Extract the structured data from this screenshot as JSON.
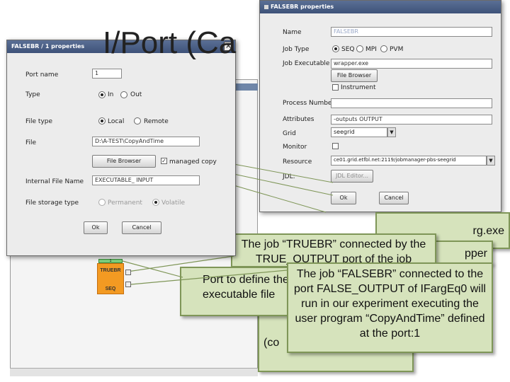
{
  "slide": {
    "title": "I/Port (Ca"
  },
  "workflow": {
    "job_node": {
      "top_label": "TRUEBR",
      "bottom_label": "SEQ",
      "input_port": "1"
    }
  },
  "callouts": {
    "back_right_tail": "rg.exe",
    "back_right_tail2": "pper",
    "truebr": "The job “TRUEBR” connected by the TRUE_OUTPUT port of the job",
    "port_to": "Port to define the executable file",
    "falsebr": "The job “FALSEBR” connected to the port FALSE_OUTPUT of IFargEq0 will run in our experiment executing the user program “CopyAndTime” defined at the port:1",
    "back_bottom": "(co"
  },
  "port_dialog": {
    "title": "FALSEBR / 1 properties",
    "port_name_label": "Port name",
    "port_name_value": "1",
    "type_label": "Type",
    "type_in": "In",
    "type_out": "Out",
    "file_type_label": "File type",
    "file_type_local": "Local",
    "file_type_remote": "Remote",
    "file_label": "File",
    "file_value": "D:\\A-TEST\\CopyAndTime",
    "file_browser_button": "File Browser",
    "managed_copy_label": "managed copy",
    "internal_name_label": "Internal File Name",
    "internal_name_value": "EXECUTABLE_ INPUT",
    "storage_label": "File storage type",
    "storage_permanent": "Permanent",
    "storage_volatile": "Volatile",
    "ok_button": "Ok",
    "cancel_button": "Cancel"
  },
  "job_dialog": {
    "title": "FALSEBR properties",
    "name_label": "Name",
    "name_value": "FALSEBR",
    "job_type_label": "Job Type",
    "job_type_seq": "SEQ",
    "job_type_mpi": "MPI",
    "job_type_pvm": "PVM",
    "job_exec_label": "Job Executable",
    "job_exec_value": "wrapper.exe",
    "file_browser_button": "File Browser",
    "instrument_label": "Instrument",
    "process_number_label": "Process Number",
    "attributes_label": "Attributes",
    "attributes_value": "-outputs OUTPUT",
    "grid_label": "Grid",
    "grid_value": "seegrid",
    "monitor_label": "Monitor",
    "resource_label": "Resource",
    "resource_value": "ce01.grid.etfbl.net:2119/jobmanager-pbs-seegrid",
    "jdl_label": "JDL:",
    "jdl_button": "JDL Editor...",
    "ok_button": "Ok",
    "cancel_button": "Cancel"
  }
}
